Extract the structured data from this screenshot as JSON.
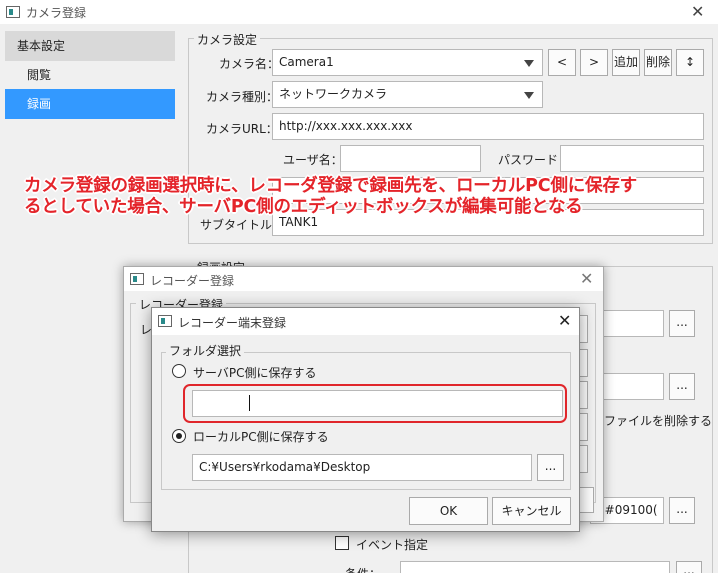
{
  "window": {
    "title": "カメラ登録",
    "close": "✕"
  },
  "sidebar": {
    "items": [
      {
        "label": "基本設定"
      },
      {
        "label": "閲覧"
      },
      {
        "label": "録画"
      }
    ]
  },
  "camera_settings": {
    "group_title": "カメラ設定",
    "name_label": "カメラ名：",
    "name_value": "Camera1",
    "prev_btn": "<",
    "next_btn": ">",
    "add_btn": "追加",
    "delete_btn": "削除",
    "sort_btn": "↕",
    "type_label": "カメラ種別：",
    "type_value": "ネットワークカメラ",
    "url_label": "カメラURL：",
    "url_value": "http://xxx.xxx.xxx.xxx",
    "user_label": "ユーザ名：",
    "user_value": "",
    "password_label": "パスワード：",
    "password_value": "",
    "subtitle_label": "サブタイトル：",
    "subtitle_value": "TANK1"
  },
  "recording_settings": {
    "group_title": "録画設定",
    "browse_btn": "...",
    "delete_old_label": "いファイルを削除する",
    "partial_value": "0#09100(",
    "event_label": "イベント指定",
    "condition_label": "条件："
  },
  "annotation": {
    "text": "カメラ登録の録画選択時に、レコーダ登録で録画先を、ローカルPC側に保存す\nるとしていた場合、サーバPC側のエディットボックスが編集可能となる"
  },
  "recorder_dialog": {
    "title": "レコーダー登録",
    "group_title": "レコーダー登録",
    "partial_label": "レ"
  },
  "terminal_dialog": {
    "title": "レコーダー端末登録",
    "group_title": "フォルダ選択",
    "server_option": "サーバPC側に保存する",
    "server_path": "",
    "local_option": "ローカルPC側に保存する",
    "local_path": "C:¥Users¥rkodama¥Desktop",
    "browse_btn": "...",
    "ok_btn": "OK",
    "cancel_btn": "キャンセル",
    "selected": "local"
  },
  "colors": {
    "selection": "#3399ff",
    "annotation": "#e4242a",
    "highlight": "#e0262b"
  }
}
